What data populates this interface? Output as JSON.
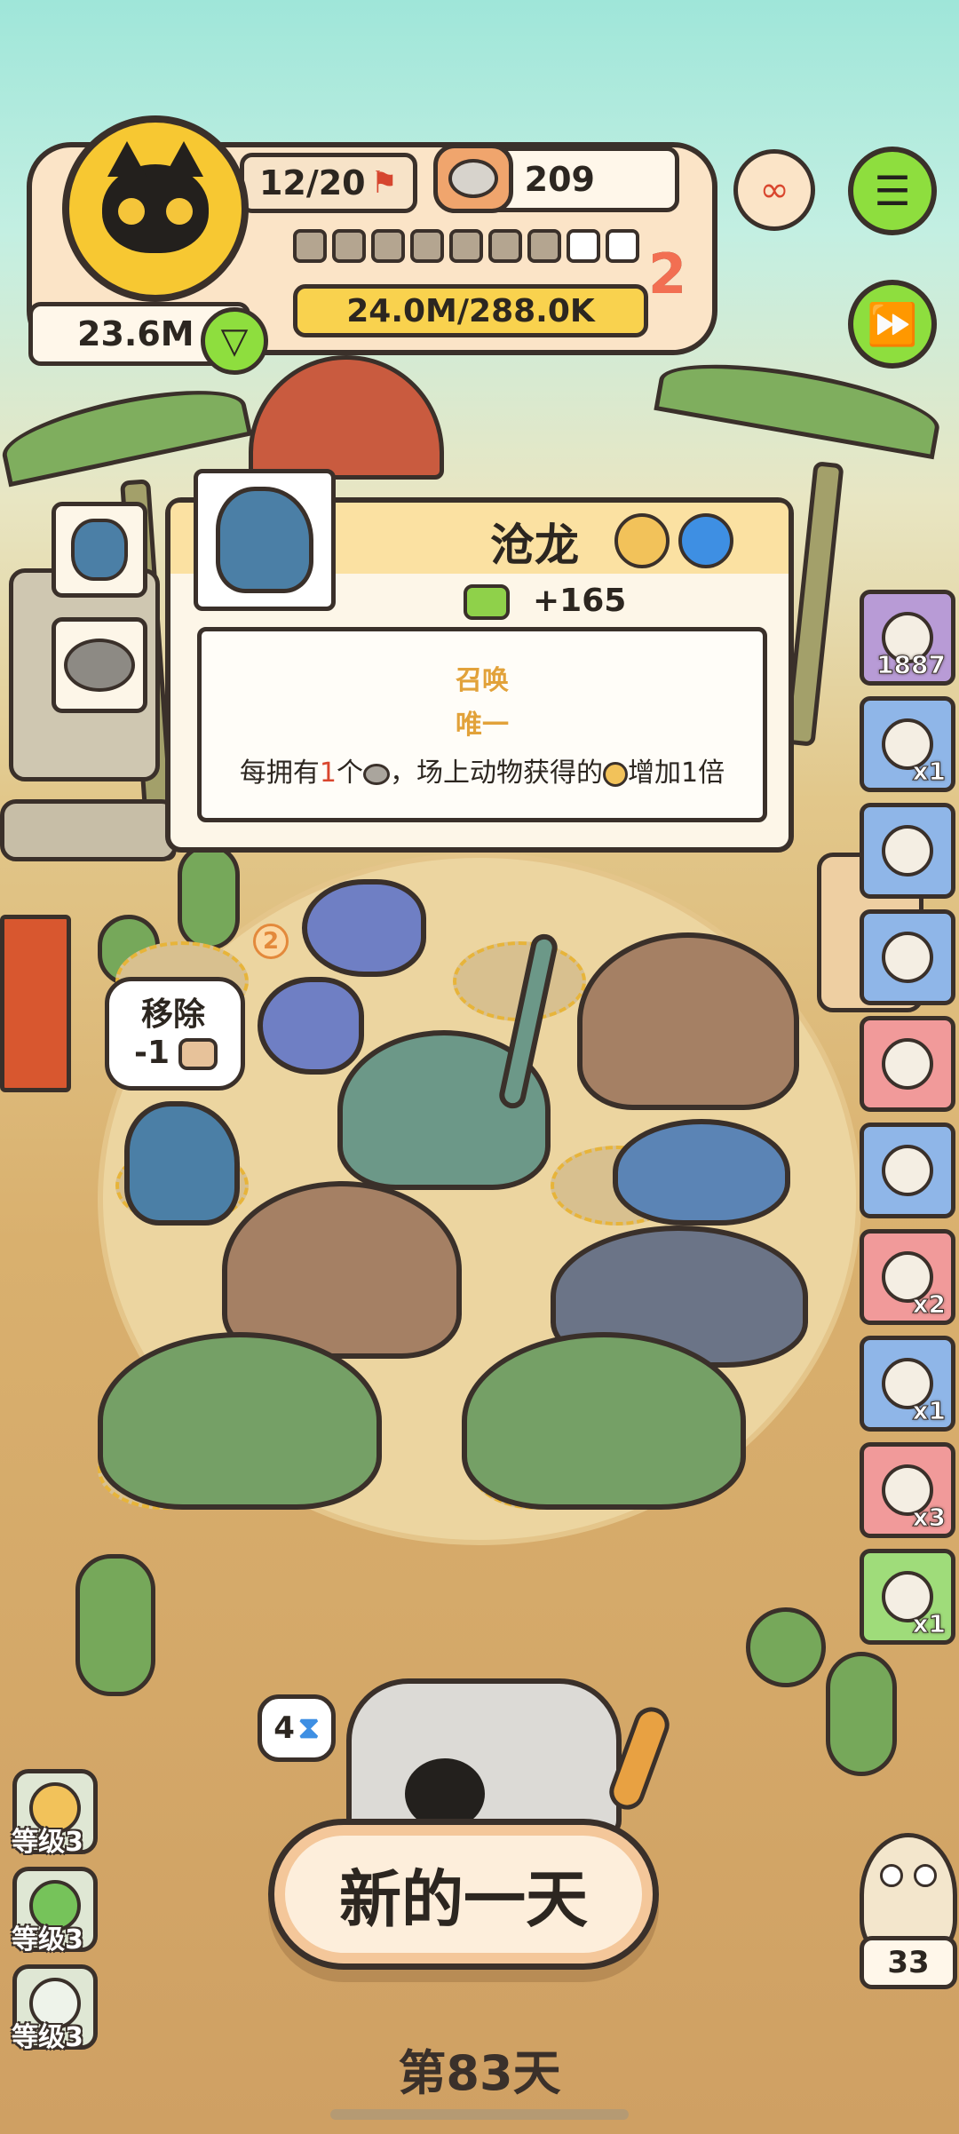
{
  "hud": {
    "stage_progress": "12/20",
    "food_count": "209",
    "coins": "23.6M",
    "exp_text": "24.0M/288.0K",
    "level_number": "2",
    "progress_total_segments": 9,
    "progress_filled_segments": 7
  },
  "popup": {
    "title": "沧龙",
    "bonus": "+165",
    "tags": [
      "召唤",
      "唯一"
    ],
    "desc_prefix": "每拥有",
    "desc_count": "1",
    "desc_mid": "个",
    "desc_suffix": "，场上动物获得的",
    "desc_end": "增加1倍"
  },
  "remove_bubble": {
    "label": "移除",
    "cost": "-1"
  },
  "side_items": [
    {
      "count": "1887",
      "color": "#b89bd6"
    },
    {
      "count": "x1",
      "color": "#8fb6e8"
    },
    {
      "count": "",
      "color": "#8fb6e8"
    },
    {
      "count": "",
      "color": "#8fb6e8"
    },
    {
      "count": "",
      "color": "#f19a9a"
    },
    {
      "count": "",
      "color": "#8fb6e8"
    },
    {
      "count": "x2",
      "color": "#f19a9a"
    },
    {
      "count": "x1",
      "color": "#8fb6e8"
    },
    {
      "count": "x3",
      "color": "#f19a9a"
    },
    {
      "count": "x1",
      "color": "#9fdc7a"
    }
  ],
  "levels": [
    "等级3",
    "等级3",
    "等级3"
  ],
  "timer_bubble": "4",
  "new_day_button": "新的一天",
  "day_label": "第83天",
  "companion_count": "33",
  "chip_badge": "2"
}
